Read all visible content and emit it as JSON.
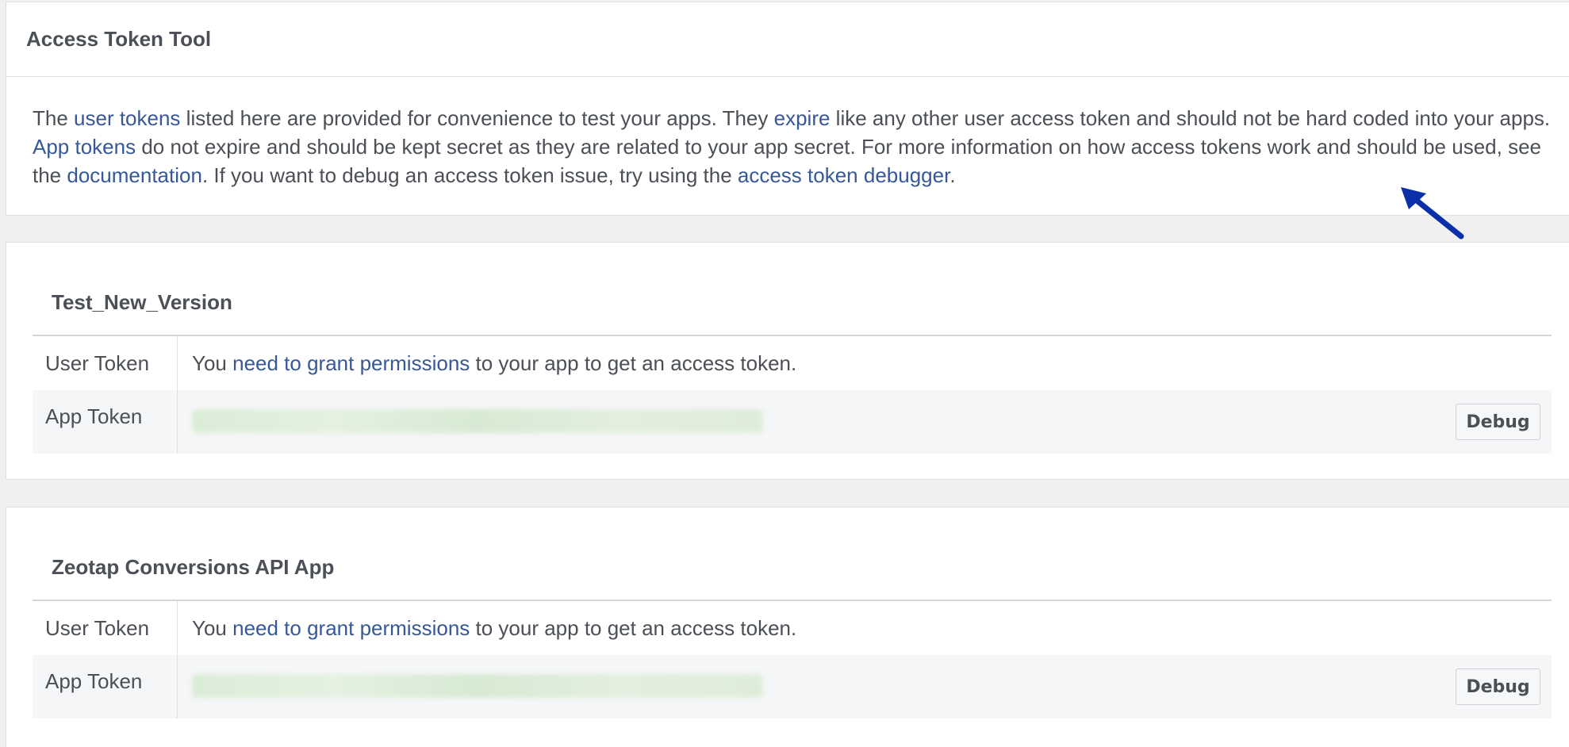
{
  "intro_panel": {
    "title": "Access Token Tool",
    "text": {
      "t1": "The ",
      "link_user_tokens": "user tokens",
      "t2": " listed here are provided for convenience to test your apps. They ",
      "link_expire": "expire",
      "t3": " like any other user access token and should not be hard coded into your apps. ",
      "link_app_tokens": "App tokens",
      "t4": " do not expire and should be kept secret as they are related to your app secret. For more information on how access tokens work and should be used, see the ",
      "link_documentation": "documentation",
      "t5": ". If you want to debug an access token issue, try using the ",
      "link_debugger": "access token debugger",
      "t6": "."
    }
  },
  "apps": [
    {
      "name": "Test_New_Version",
      "user_token_label": "User Token",
      "user_token_text": {
        "prefix": "You ",
        "link": "need to grant permissions",
        "suffix": " to your app to get an access token."
      },
      "app_token_label": "App Token",
      "debug_label": "Debug"
    },
    {
      "name": "Zeotap Conversions API App",
      "user_token_label": "User Token",
      "user_token_text": {
        "prefix": "You ",
        "link": "need to grant permissions",
        "suffix": " to your app to get an access token."
      },
      "app_token_label": "App Token",
      "debug_label": "Debug"
    }
  ],
  "colors": {
    "link": "#365899",
    "text": "#4b4f56",
    "annotation_arrow": "#0b2fa8"
  },
  "icons": {
    "annotation": "arrow-pointer-icon"
  }
}
